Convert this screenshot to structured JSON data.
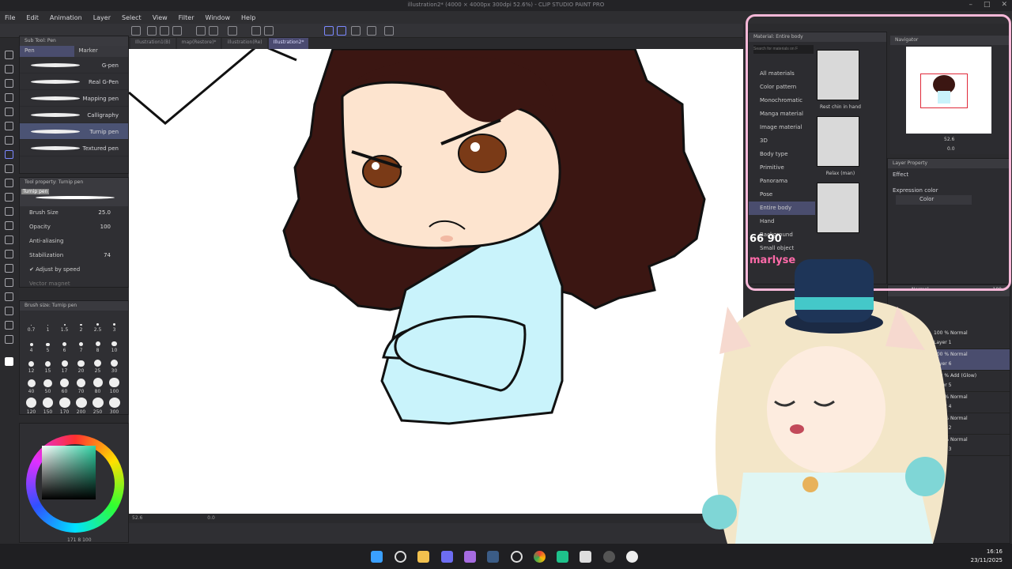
{
  "window": {
    "title": "illustration2* (4000 × 4000px 300dpi 52.6%) - CLIP STUDIO PAINT PRO"
  },
  "menu": [
    "File",
    "Edit",
    "Animation",
    "Layer",
    "Select",
    "View",
    "Filter",
    "Window",
    "Help"
  ],
  "tabs": [
    "Illustration1(B)",
    "map(Restore)*",
    "illustration(Re)",
    "Illustration2*"
  ],
  "subtool": {
    "header": "Sub Tool: Pen",
    "tabs": [
      "Pen",
      "Marker"
    ],
    "brushes": [
      "G-pen",
      "Real G-Pen",
      "Mapping pen",
      "Calligraphy",
      "Turnip pen",
      "Textured pen"
    ],
    "selected": "Turnip pen"
  },
  "tool_property": {
    "header": "Tool property: Turnip pen",
    "preview_label": "Turnip pen",
    "brush_size_label": "Brush Size",
    "brush_size_value": "25.0",
    "opacity_label": "Opacity",
    "opacity_value": "100",
    "antialias_label": "Anti-aliasing",
    "stabilization_label": "Stabilization",
    "stabilization_value": "74",
    "adjust_speed_label": "Adjust by speed",
    "vector_magnet_label": "Vector magnet"
  },
  "brush_size_panel": {
    "header": "Brush size: Turnip pen",
    "sizes": [
      "0.7",
      "1",
      "1.5",
      "2",
      "2.5",
      "3",
      "4",
      "5",
      "6",
      "7",
      "8",
      "10",
      "12",
      "15",
      "17",
      "20",
      "25",
      "30",
      "40",
      "50",
      "60",
      "70",
      "80",
      "100",
      "120",
      "150",
      "170",
      "200",
      "250",
      "300"
    ]
  },
  "color_panel": {
    "main_color": "#2fd3a4",
    "readout": "171  8  100"
  },
  "status": {
    "zoom": "52.6",
    "angle": "0.0"
  },
  "material": {
    "header": "Material: Entire body",
    "search_placeholder": "Search for materials on F",
    "tree": [
      "All materials",
      "Color pattern",
      "Monochromatic",
      "Manga material",
      "Image material",
      "3D",
      "Body type",
      "Primitive",
      "Panorama",
      "Pose",
      "Entire body",
      "Hand",
      "Background",
      "Small object"
    ],
    "selected": "Entire body",
    "thumbs": [
      "Rest chin in hand",
      "Relax (man)",
      ""
    ]
  },
  "navigator": {
    "header": "Navigator",
    "zoom": "52.6",
    "angle": "0.0"
  },
  "layer_property": {
    "header": "Layer Property",
    "effect_label": "Effect",
    "expression_label": "Expression color",
    "expression_value": "Color"
  },
  "layers": {
    "blend": "Normal",
    "opacity": "100",
    "items": [
      {
        "mode": "100 % Normal",
        "name": "Layer 1"
      },
      {
        "mode": "100 % Normal",
        "name": "Layer 6"
      },
      {
        "mode": "100 % Add (Glow)",
        "name": "Layer 5"
      },
      {
        "mode": "100 % Normal",
        "name": "Layer 4"
      },
      {
        "mode": "100 % Normal",
        "name": "Layer 2"
      },
      {
        "mode": "100 % Normal",
        "name": "Layer 3"
      }
    ],
    "selected": "Layer 6"
  },
  "overlay": {
    "line1": "66 90",
    "line2": "marlyse"
  },
  "colors": {
    "accent": "#4a4d6e",
    "hair": "#3b1612",
    "skin": "#fde4cf",
    "shirt": "#c9f3fb",
    "frame": "#f7b8d8"
  },
  "taskbar": {
    "icons": [
      "windows-icon",
      "search-icon",
      "file-explorer-icon",
      "discord-icon",
      "app-icon",
      "steam-icon",
      "settings-icon",
      "chrome-icon",
      "terminal-icon",
      "clip-studio-icon",
      "obs-icon",
      "github-icon"
    ]
  },
  "clock": {
    "time": "16:16",
    "date": "23/11/2025"
  }
}
